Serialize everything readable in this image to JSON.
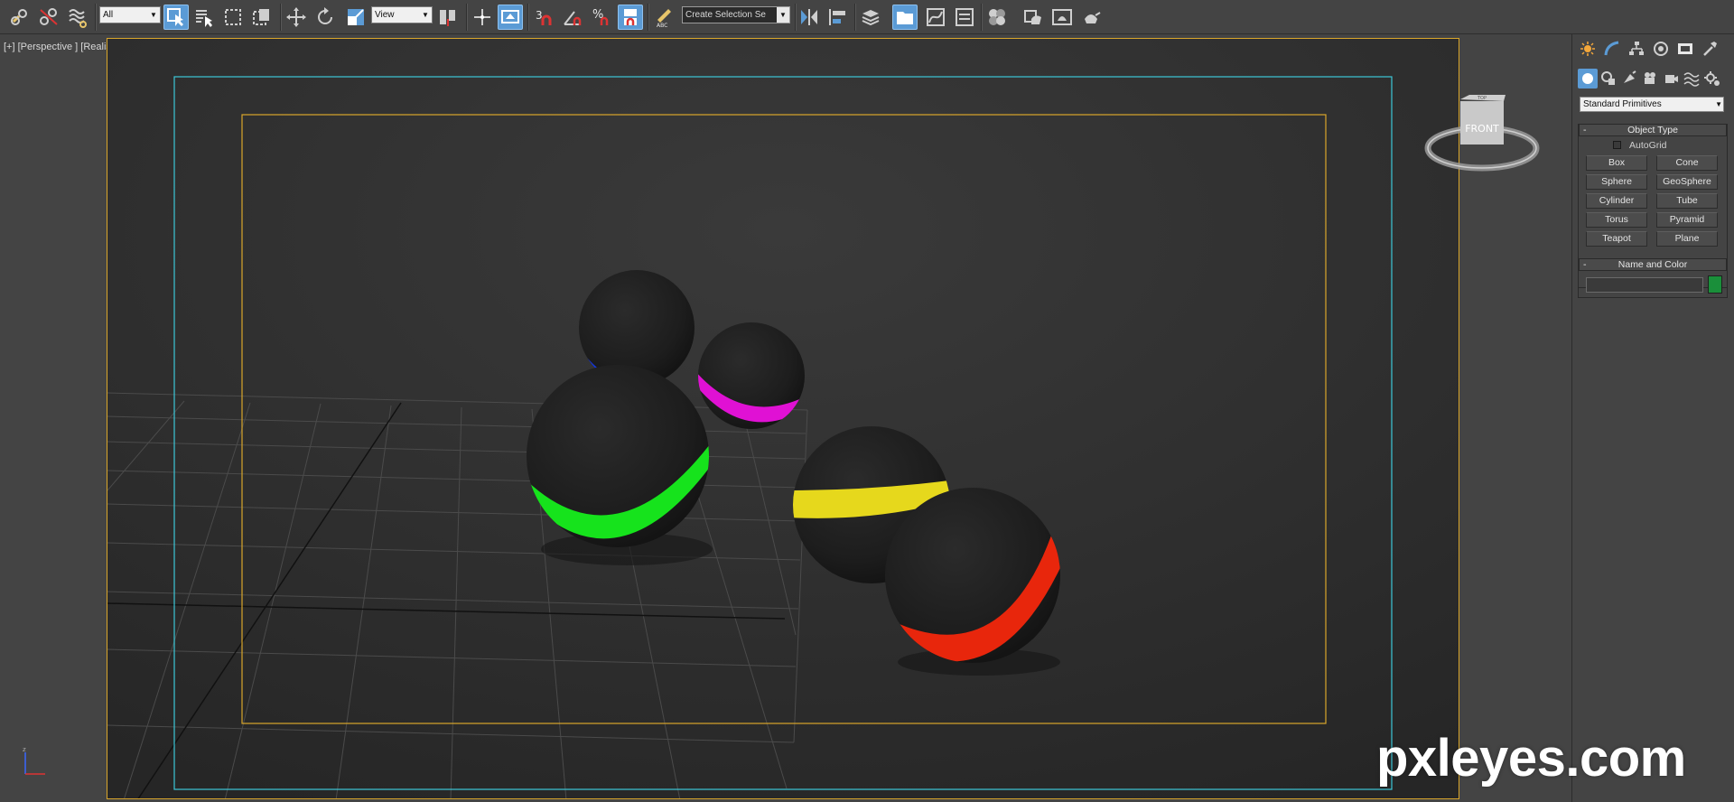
{
  "toolbar": {
    "selection_filter": "All",
    "reference_coord": "View",
    "snap_angle_label": "3",
    "percent_snap_label": "%",
    "named_selection_placeholder": "Create Selection Se",
    "spinner_snap_label": "ABC"
  },
  "viewport": {
    "label": "[+] [Perspective ] [Realistic ]",
    "viewcube_top": "TOP",
    "viewcube_face": "FRONT",
    "axis_z": "z",
    "axis_x": "x"
  },
  "command_panel": {
    "category_dropdown": "Standard Primitives",
    "object_type": {
      "title": "Object Type",
      "autogrid_label": "AutoGrid",
      "buttons": [
        "Box",
        "Cone",
        "Sphere",
        "GeoSphere",
        "Cylinder",
        "Tube",
        "Torus",
        "Pyramid",
        "Teapot",
        "Plane"
      ]
    },
    "name_and_color": {
      "title": "Name and Color",
      "name_value": "",
      "color": "#1a8f3a"
    }
  },
  "scene": {
    "spheres": [
      {
        "name": "sphere-blue",
        "band_color": "#1336e0"
      },
      {
        "name": "sphere-magenta",
        "band_color": "#e011d4"
      },
      {
        "name": "sphere-green",
        "band_color": "#16e31c"
      },
      {
        "name": "sphere-yellow",
        "band_color": "#e6d81c"
      },
      {
        "name": "sphere-red",
        "band_color": "#e8260c"
      }
    ],
    "safe_frame_outer_color": "#3cc7d8",
    "safe_frame_inner_color": "#d9a62b"
  },
  "watermark": "pxleyes.com"
}
